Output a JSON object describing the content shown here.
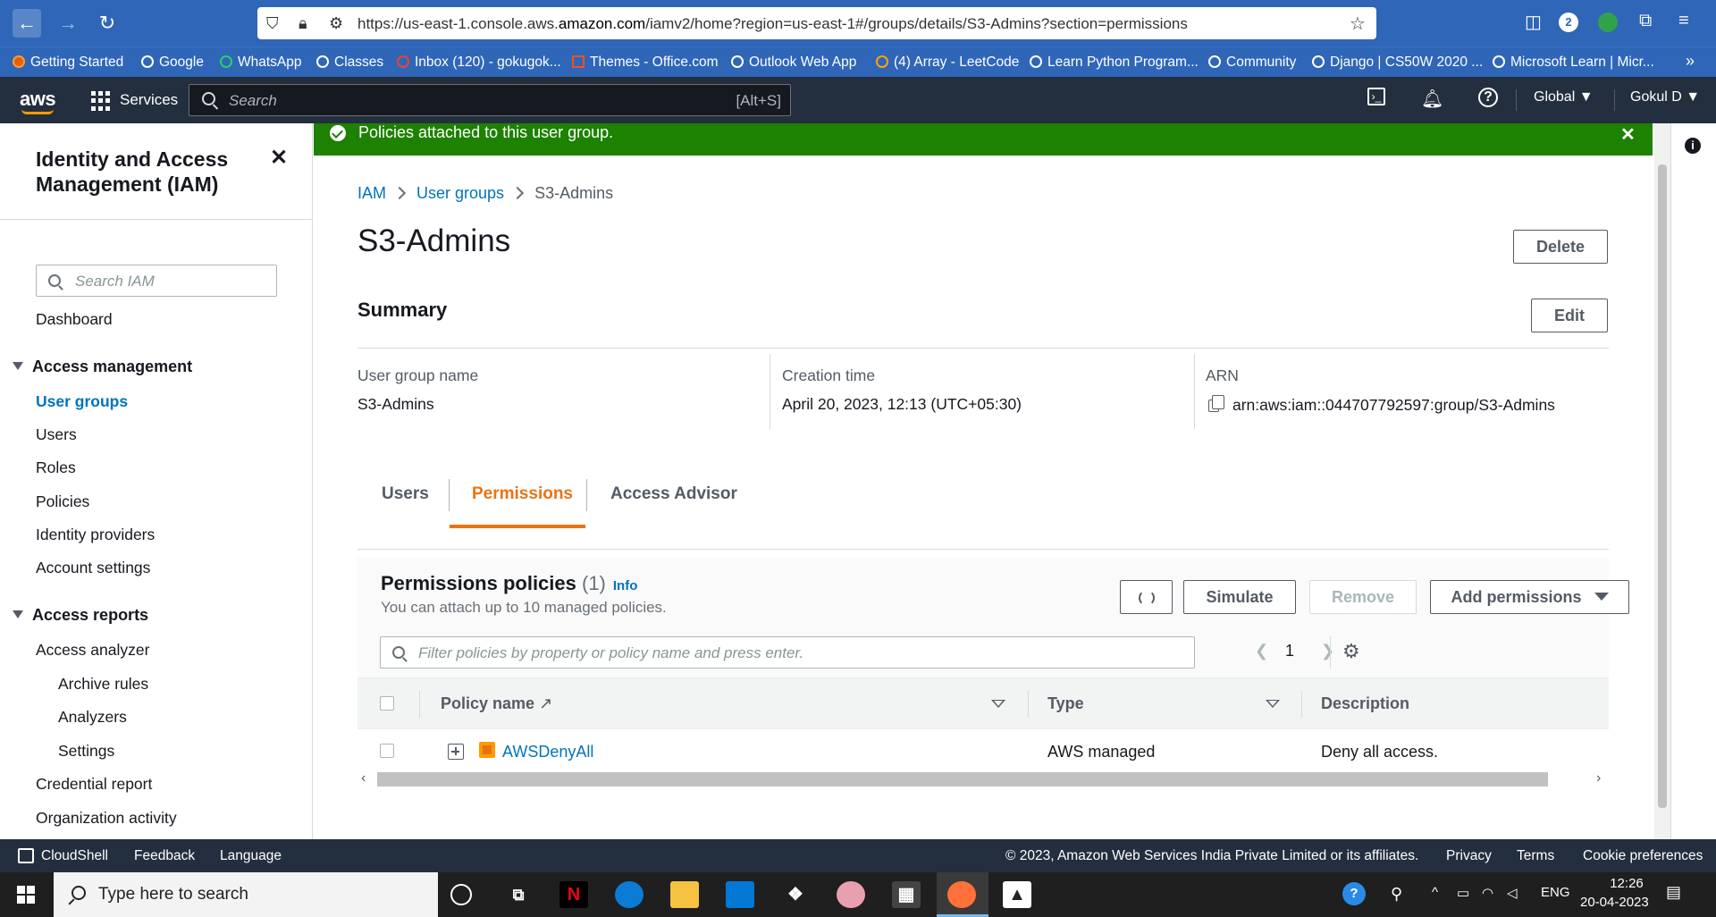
{
  "browser": {
    "url_prefix": "https://us-east-1.console.aws.",
    "url_domain": "amazon.com",
    "url_suffix": "/iamv2/home?region=us-east-1#/groups/details/S3-Admins?section=permissions",
    "badge_count": "2",
    "bookmarks": [
      "Getting Started",
      "Google",
      "WhatsApp",
      "Classes",
      "Inbox (120) - gokugok...",
      "Themes - Office.com",
      "Outlook Web App",
      "(4) Array - LeetCode",
      "Learn Python Program...",
      "Community",
      "Django | CS50W 2020 ...",
      "Microsoft Learn | Micr..."
    ]
  },
  "aws_nav": {
    "logo": "aws",
    "services": "Services",
    "search_placeholder": "Search",
    "search_shortcut": "[Alt+S]",
    "region": "Global",
    "user": "Gokul D"
  },
  "sidebar": {
    "title": "Identity and Access Management (IAM)",
    "search_placeholder": "Search IAM",
    "dashboard": "Dashboard",
    "access_management": "Access management",
    "items": [
      "User groups",
      "Users",
      "Roles",
      "Policies",
      "Identity providers",
      "Account settings"
    ],
    "access_reports": "Access reports",
    "reports": [
      "Access analyzer",
      "Archive rules",
      "Analyzers",
      "Settings",
      "Credential report",
      "Organization activity"
    ]
  },
  "flash": {
    "message": "Policies attached to this user group."
  },
  "breadcrumb": {
    "items": [
      "IAM",
      "User groups",
      "S3-Admins"
    ]
  },
  "page": {
    "title": "S3-Admins",
    "delete_label": "Delete",
    "summary_title": "Summary",
    "edit_label": "Edit"
  },
  "summary": {
    "group_name_label": "User group name",
    "group_name": "S3-Admins",
    "creation_label": "Creation time",
    "creation_time": "April 20, 2023, 12:13 (UTC+05:30)",
    "arn_label": "ARN",
    "arn": "arn:aws:iam::044707792597:group/S3-Admins"
  },
  "tabs": [
    "Users",
    "Permissions",
    "Access Advisor"
  ],
  "permissions": {
    "title": "Permissions policies",
    "count": "(1)",
    "info": "Info",
    "description": "You can attach up to 10 managed policies.",
    "simulate": "Simulate",
    "remove": "Remove",
    "add_permissions": "Add permissions",
    "filter_placeholder": "Filter policies by property or policy name and press enter.",
    "page": "1",
    "columns": [
      "Policy name",
      "Type",
      "Description"
    ],
    "rows": [
      {
        "name": "AWSDenyAll",
        "type": "AWS managed",
        "description": "Deny all access."
      }
    ]
  },
  "footer": {
    "cloudshell": "CloudShell",
    "feedback": "Feedback",
    "language": "Language",
    "copyright": "© 2023, Amazon Web Services India Private Limited or its affiliates.",
    "privacy": "Privacy",
    "terms": "Terms",
    "cookies": "Cookie preferences"
  },
  "taskbar": {
    "search_placeholder": "Type here to search",
    "lang": "ENG",
    "time": "12:26",
    "date": "20-04-2023"
  },
  "colors": {
    "aws_nav": "#232f3e",
    "link": "#0073bb",
    "accent": "#ec7211",
    "success": "#1d8102",
    "browser": "#2f66b8"
  }
}
